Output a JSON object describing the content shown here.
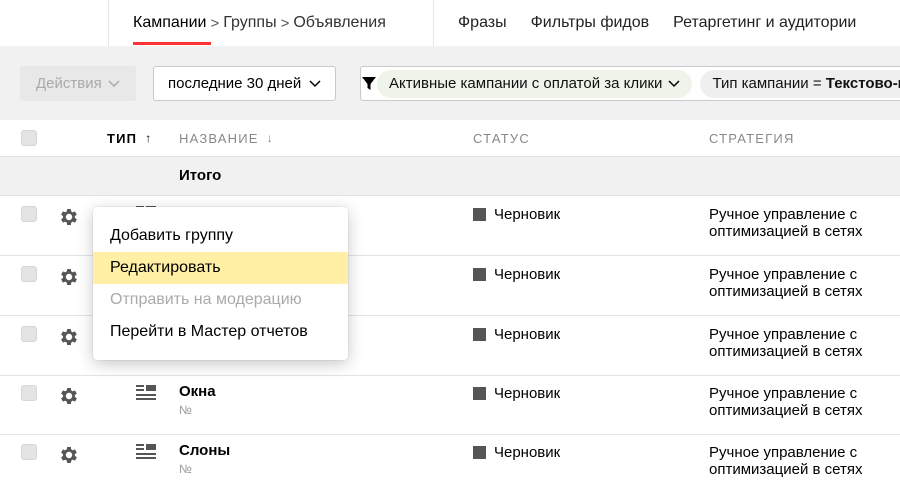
{
  "topnav": {
    "breadcrumbs": [
      "Кампании",
      "Группы",
      "Объявления"
    ],
    "separator": ">",
    "links": [
      "Фразы",
      "Фильтры фидов",
      "Ретаргетинг и аудитории"
    ]
  },
  "toolbar": {
    "actions_label": "Действия",
    "period_label": "последние 30 дней",
    "filters": [
      {
        "label": "Активные кампании с оплатой за клики",
        "has_chevron": true
      },
      {
        "key": "Тип кампании",
        "op": " = ",
        "value": "Текстово-графические"
      }
    ]
  },
  "table": {
    "headers": {
      "type": "Тип",
      "type_sort": "↑",
      "name": "Название",
      "name_sort": "↓",
      "status": "Статус",
      "strategy": "Стратегия"
    },
    "total_label": "Итого",
    "rows": [
      {
        "name": "",
        "num": "",
        "status": "Черновик",
        "strategy": "Ручное управление с оптимизацией в сетях"
      },
      {
        "name": "",
        "num": "",
        "status": "Черновик",
        "strategy": "Ручное управление с оптимизацией в сетях"
      },
      {
        "name": "",
        "num": "",
        "status": "Черновик",
        "strategy": "Ручное управление с оптимизацией в сетях"
      },
      {
        "name": "Окна",
        "num": "№",
        "status": "Черновик",
        "strategy": "Ручное управление с оптимизацией в сетях"
      },
      {
        "name": "Слоны",
        "num": "№",
        "status": "Черновик",
        "strategy": "Ручное управление с оптимизацией в сетях"
      }
    ]
  },
  "context_menu": {
    "items": [
      {
        "label": "Добавить группу",
        "state": "normal"
      },
      {
        "label": "Редактировать",
        "state": "highlighted"
      },
      {
        "label": "Отправить на модерацию",
        "state": "disabled"
      },
      {
        "label": "Перейти в Мастер отчетов",
        "state": "normal"
      }
    ]
  },
  "icons": {
    "row_settings": "gear-icon",
    "row_type": "text-campaign-icon",
    "filter": "filter-icon",
    "dropdown": "chevron-down-icon"
  },
  "colors": {
    "accent_underline": "#ff3333",
    "highlight": "#fff0a6",
    "chip_green": "#eef4ea",
    "status_draft": "#555555"
  }
}
